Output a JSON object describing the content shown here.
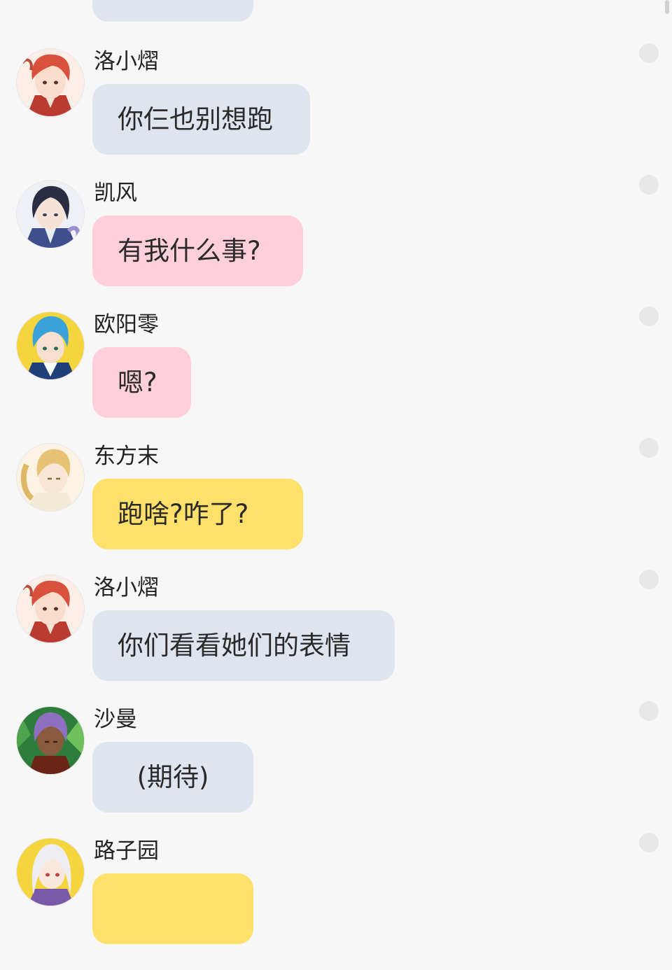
{
  "colors": {
    "background": "#f7f7f7",
    "bubble_gray": "#dfe5ee",
    "bubble_pink": "#ffd0dc",
    "bubble_yellow": "#ffe06a",
    "dot": "#e8e8e8"
  },
  "messages": [
    {
      "sender": "洛小熠",
      "text": "你仨也别想跑",
      "bubble_color": "gray",
      "avatar_icon": "red-hair-boy-avatar-icon"
    },
    {
      "sender": "凯风",
      "text": "有我什么事?",
      "bubble_color": "pink",
      "avatar_icon": "dark-hair-boy-avatar-icon"
    },
    {
      "sender": "欧阳零",
      "text": "嗯?",
      "bubble_color": "pink",
      "avatar_icon": "blue-hair-boy-avatar-icon"
    },
    {
      "sender": "东方末",
      "text": "跑啥?咋了?",
      "bubble_color": "yellow",
      "avatar_icon": "blonde-hair-boy-avatar-icon"
    },
    {
      "sender": "洛小熠",
      "text": "你们看看她们的表情",
      "bubble_color": "gray",
      "avatar_icon": "red-hair-boy-avatar-icon"
    },
    {
      "sender": "沙曼",
      "text": "(期待)",
      "bubble_color": "gray",
      "avatar_icon": "purple-hair-girl-avatar-icon"
    },
    {
      "sender": "路子园",
      "text": "",
      "bubble_color": "yellow",
      "avatar_icon": "white-hair-girl-avatar-icon"
    }
  ]
}
